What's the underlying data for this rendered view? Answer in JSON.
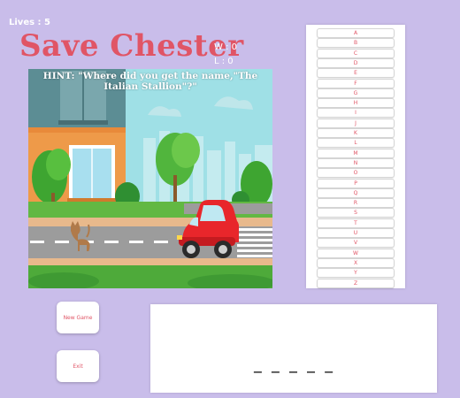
{
  "status": {
    "lives": "Lives : 5",
    "wins": "W : 0",
    "losses": "L : 0"
  },
  "game": {
    "title": "Save Chester",
    "hint": "HINT: \"Where did you get the name,\"The Italian Stallion\"?\""
  },
  "letters": [
    "A",
    "B",
    "C",
    "D",
    "E",
    "F",
    "G",
    "H",
    "I",
    "J",
    "K",
    "L",
    "M",
    "N",
    "O",
    "P",
    "Q",
    "R",
    "S",
    "T",
    "U",
    "V",
    "W",
    "X",
    "Y",
    "Z"
  ],
  "buttons": {
    "new_game": "New Game",
    "exit": "Exit"
  },
  "answer": {
    "blanks": "_ _ _ _ _"
  },
  "colors": {
    "background": "#c9bdea",
    "accent": "#e05566",
    "car": "#e8262b"
  },
  "icons": {
    "character": "cat-icon",
    "vehicle": "car-icon"
  }
}
